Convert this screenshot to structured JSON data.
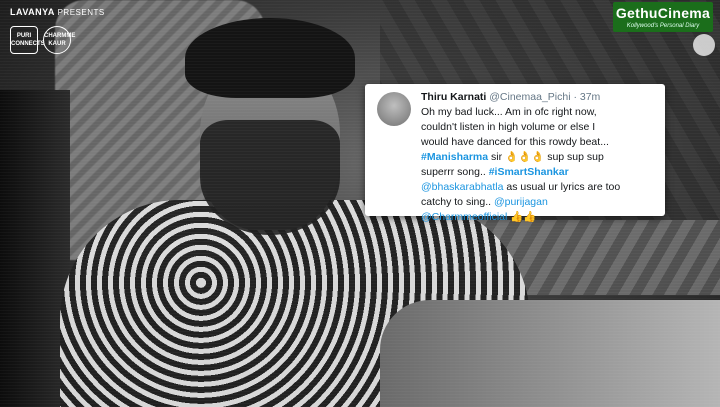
{
  "branding": {
    "presenter_name": "LAVANYA",
    "presenter_word": "PRESENTS",
    "logo_left": "PURI CONNECTS",
    "logo_right": "CHARMME KAUR",
    "site_name": "GethuCinema",
    "site_tagline": "Kollywood's Personal Diary"
  },
  "tweet": {
    "name": "Thiru Karnati",
    "handle": "@Cinemaa_Pichi",
    "time": "· 37m",
    "line1": "Oh my bad luck... Am in ofc right now,",
    "line2": "couldn't listen in high volume or else I",
    "line3": "would have danced for this rowdy beat...",
    "hashtag1": "#Manisharma",
    "sir": " sir ",
    "emoji_ok": "👌👌👌",
    "sup": " sup sup sup",
    "line5a": "superrr song.. ",
    "hashtag2": "#iSmartShankar",
    "mention1": "@bhaskarabhatla",
    "line6b": " as usual ur lyrics are too",
    "line7a": "catchy to sing.. ",
    "mention2": "@purijagan",
    "mention3": "@Charmmeofficial",
    "emoji_thumbs": " 👍👍"
  }
}
